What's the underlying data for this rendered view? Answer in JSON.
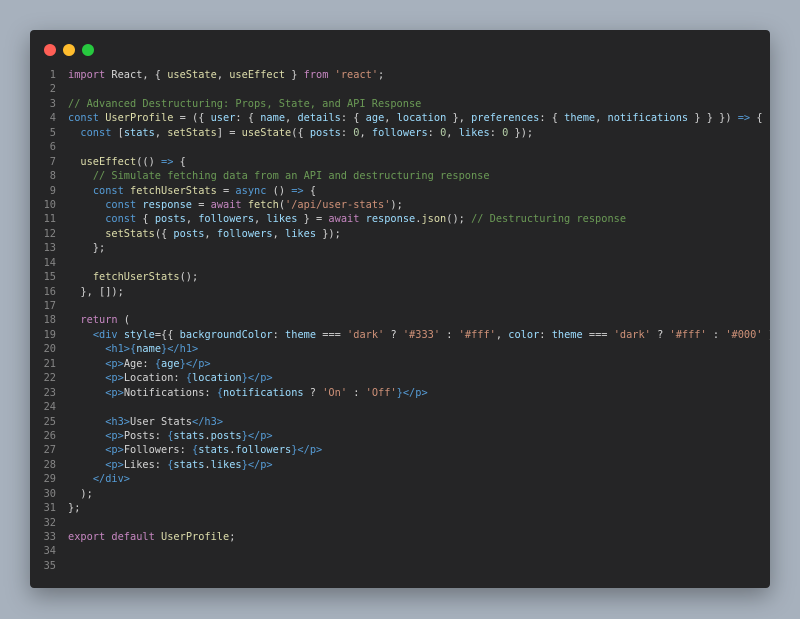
{
  "window": {
    "traffic_lights": [
      {
        "name": "close",
        "color": "#ff5f56"
      },
      {
        "name": "minimize",
        "color": "#ffbd2e"
      },
      {
        "name": "maximize",
        "color": "#27c93f"
      }
    ]
  },
  "colors": {
    "background": "#a7b1bd",
    "editor": "#252526",
    "keyword": "#c586c0",
    "storage": "#569cd6",
    "function": "#dcdcaa",
    "variable": "#9cdcfe",
    "string": "#ce9178",
    "number": "#b5cea8",
    "comment": "#6a9955",
    "text": "#d4d4d4",
    "line_number": "#858585"
  },
  "code": {
    "lines": [
      {
        "n": "1",
        "tokens": [
          [
            "kw",
            "import"
          ],
          [
            "txt",
            " React, { "
          ],
          [
            "fn",
            "useState"
          ],
          [
            "txt",
            ", "
          ],
          [
            "fn",
            "useEffect"
          ],
          [
            "txt",
            " } "
          ],
          [
            "kw",
            "from"
          ],
          [
            "txt",
            " "
          ],
          [
            "str",
            "'react'"
          ],
          [
            "txt",
            ";"
          ]
        ]
      },
      {
        "n": "2",
        "tokens": []
      },
      {
        "n": "3",
        "tokens": [
          [
            "com",
            "// Advanced Destructuring: Props, State, and API Response"
          ]
        ]
      },
      {
        "n": "4",
        "tokens": [
          [
            "kw2",
            "const"
          ],
          [
            "txt",
            " "
          ],
          [
            "fn",
            "UserProfile"
          ],
          [
            "txt",
            " = ({ "
          ],
          [
            "var",
            "user"
          ],
          [
            "txt",
            ": { "
          ],
          [
            "var",
            "name"
          ],
          [
            "txt",
            ", "
          ],
          [
            "var",
            "details"
          ],
          [
            "txt",
            ": { "
          ],
          [
            "var",
            "age"
          ],
          [
            "txt",
            ", "
          ],
          [
            "var",
            "location"
          ],
          [
            "txt",
            " }, "
          ],
          [
            "var",
            "preferences"
          ],
          [
            "txt",
            ": { "
          ],
          [
            "var",
            "theme"
          ],
          [
            "txt",
            ", "
          ],
          [
            "var",
            "notifications"
          ],
          [
            "txt",
            " } } }) "
          ],
          [
            "kw2",
            "=>"
          ],
          [
            "txt",
            " {"
          ]
        ]
      },
      {
        "n": "5",
        "tokens": [
          [
            "txt",
            "  "
          ],
          [
            "kw2",
            "const"
          ],
          [
            "txt",
            " ["
          ],
          [
            "var",
            "stats"
          ],
          [
            "txt",
            ", "
          ],
          [
            "fn",
            "setStats"
          ],
          [
            "txt",
            "] = "
          ],
          [
            "fn",
            "useState"
          ],
          [
            "txt",
            "({ "
          ],
          [
            "var",
            "posts"
          ],
          [
            "txt",
            ": "
          ],
          [
            "num",
            "0"
          ],
          [
            "txt",
            ", "
          ],
          [
            "var",
            "followers"
          ],
          [
            "txt",
            ": "
          ],
          [
            "num",
            "0"
          ],
          [
            "txt",
            ", "
          ],
          [
            "var",
            "likes"
          ],
          [
            "txt",
            ": "
          ],
          [
            "num",
            "0"
          ],
          [
            "txt",
            " });"
          ]
        ]
      },
      {
        "n": "6",
        "tokens": []
      },
      {
        "n": "7",
        "tokens": [
          [
            "txt",
            "  "
          ],
          [
            "fn",
            "useEffect"
          ],
          [
            "txt",
            "(() "
          ],
          [
            "kw2",
            "=>"
          ],
          [
            "txt",
            " {"
          ]
        ]
      },
      {
        "n": "8",
        "tokens": [
          [
            "txt",
            "    "
          ],
          [
            "com",
            "// Simulate fetching data from an API and destructuring response"
          ]
        ]
      },
      {
        "n": "9",
        "tokens": [
          [
            "txt",
            "    "
          ],
          [
            "kw2",
            "const"
          ],
          [
            "txt",
            " "
          ],
          [
            "fn",
            "fetchUserStats"
          ],
          [
            "txt",
            " = "
          ],
          [
            "kw2",
            "async"
          ],
          [
            "txt",
            " () "
          ],
          [
            "kw2",
            "=>"
          ],
          [
            "txt",
            " {"
          ]
        ]
      },
      {
        "n": "10",
        "tokens": [
          [
            "txt",
            "      "
          ],
          [
            "kw2",
            "const"
          ],
          [
            "txt",
            " "
          ],
          [
            "var",
            "response"
          ],
          [
            "txt",
            " = "
          ],
          [
            "kw",
            "await"
          ],
          [
            "txt",
            " "
          ],
          [
            "fn",
            "fetch"
          ],
          [
            "txt",
            "("
          ],
          [
            "str",
            "'/api/user-stats'"
          ],
          [
            "txt",
            ");"
          ]
        ]
      },
      {
        "n": "11",
        "tokens": [
          [
            "txt",
            "      "
          ],
          [
            "kw2",
            "const"
          ],
          [
            "txt",
            " { "
          ],
          [
            "var",
            "posts"
          ],
          [
            "txt",
            ", "
          ],
          [
            "var",
            "followers"
          ],
          [
            "txt",
            ", "
          ],
          [
            "var",
            "likes"
          ],
          [
            "txt",
            " } = "
          ],
          [
            "kw",
            "await"
          ],
          [
            "txt",
            " "
          ],
          [
            "var",
            "response"
          ],
          [
            "txt",
            "."
          ],
          [
            "fn",
            "json"
          ],
          [
            "txt",
            "(); "
          ],
          [
            "com",
            "// Destructuring response"
          ]
        ]
      },
      {
        "n": "12",
        "tokens": [
          [
            "txt",
            "      "
          ],
          [
            "fn",
            "setStats"
          ],
          [
            "txt",
            "({ "
          ],
          [
            "var",
            "posts"
          ],
          [
            "txt",
            ", "
          ],
          [
            "var",
            "followers"
          ],
          [
            "txt",
            ", "
          ],
          [
            "var",
            "likes"
          ],
          [
            "txt",
            " });"
          ]
        ]
      },
      {
        "n": "13",
        "tokens": [
          [
            "txt",
            "    };"
          ]
        ]
      },
      {
        "n": "14",
        "tokens": []
      },
      {
        "n": "15",
        "tokens": [
          [
            "txt",
            "    "
          ],
          [
            "fn",
            "fetchUserStats"
          ],
          [
            "txt",
            "();"
          ]
        ]
      },
      {
        "n": "16",
        "tokens": [
          [
            "txt",
            "  }, []);"
          ]
        ]
      },
      {
        "n": "17",
        "tokens": []
      },
      {
        "n": "18",
        "tokens": [
          [
            "txt",
            "  "
          ],
          [
            "kw",
            "return"
          ],
          [
            "txt",
            " ("
          ]
        ]
      },
      {
        "n": "19",
        "tokens": [
          [
            "txt",
            "    "
          ],
          [
            "tag",
            "<div"
          ],
          [
            "txt",
            " "
          ],
          [
            "var",
            "style"
          ],
          [
            "txt",
            "={{ "
          ],
          [
            "var",
            "backgroundColor"
          ],
          [
            "txt",
            ": "
          ],
          [
            "var",
            "theme"
          ],
          [
            "txt",
            " === "
          ],
          [
            "str",
            "'dark'"
          ],
          [
            "txt",
            " ? "
          ],
          [
            "str",
            "'#333'"
          ],
          [
            "txt",
            " : "
          ],
          [
            "str",
            "'#fff'"
          ],
          [
            "txt",
            ", "
          ],
          [
            "var",
            "color"
          ],
          [
            "txt",
            ": "
          ],
          [
            "var",
            "theme"
          ],
          [
            "txt",
            " === "
          ],
          [
            "str",
            "'dark'"
          ],
          [
            "txt",
            " ? "
          ],
          [
            "str",
            "'#fff'"
          ],
          [
            "txt",
            " : "
          ],
          [
            "str",
            "'#000'"
          ],
          [
            "txt",
            " }}"
          ],
          [
            "tag",
            ">"
          ]
        ]
      },
      {
        "n": "20",
        "tokens": [
          [
            "txt",
            "      "
          ],
          [
            "tag",
            "<h1>"
          ],
          [
            "kw2",
            "{"
          ],
          [
            "var",
            "name"
          ],
          [
            "kw2",
            "}"
          ],
          [
            "tag",
            "</h1>"
          ]
        ]
      },
      {
        "n": "21",
        "tokens": [
          [
            "txt",
            "      "
          ],
          [
            "tag",
            "<p>"
          ],
          [
            "txt",
            "Age: "
          ],
          [
            "kw2",
            "{"
          ],
          [
            "var",
            "age"
          ],
          [
            "kw2",
            "}"
          ],
          [
            "tag",
            "</p>"
          ]
        ]
      },
      {
        "n": "22",
        "tokens": [
          [
            "txt",
            "      "
          ],
          [
            "tag",
            "<p>"
          ],
          [
            "txt",
            "Location: "
          ],
          [
            "kw2",
            "{"
          ],
          [
            "var",
            "location"
          ],
          [
            "kw2",
            "}"
          ],
          [
            "tag",
            "</p>"
          ]
        ]
      },
      {
        "n": "23",
        "tokens": [
          [
            "txt",
            "      "
          ],
          [
            "tag",
            "<p>"
          ],
          [
            "txt",
            "Notifications: "
          ],
          [
            "kw2",
            "{"
          ],
          [
            "var",
            "notifications"
          ],
          [
            "txt",
            " ? "
          ],
          [
            "str",
            "'On'"
          ],
          [
            "txt",
            " : "
          ],
          [
            "str",
            "'Off'"
          ],
          [
            "kw2",
            "}"
          ],
          [
            "tag",
            "</p>"
          ]
        ]
      },
      {
        "n": "24",
        "tokens": []
      },
      {
        "n": "25",
        "tokens": [
          [
            "txt",
            "      "
          ],
          [
            "tag",
            "<h3>"
          ],
          [
            "txt",
            "User Stats"
          ],
          [
            "tag",
            "</h3>"
          ]
        ]
      },
      {
        "n": "26",
        "tokens": [
          [
            "txt",
            "      "
          ],
          [
            "tag",
            "<p>"
          ],
          [
            "txt",
            "Posts: "
          ],
          [
            "kw2",
            "{"
          ],
          [
            "var",
            "stats"
          ],
          [
            "txt",
            "."
          ],
          [
            "var",
            "posts"
          ],
          [
            "kw2",
            "}"
          ],
          [
            "tag",
            "</p>"
          ]
        ]
      },
      {
        "n": "27",
        "tokens": [
          [
            "txt",
            "      "
          ],
          [
            "tag",
            "<p>"
          ],
          [
            "txt",
            "Followers: "
          ],
          [
            "kw2",
            "{"
          ],
          [
            "var",
            "stats"
          ],
          [
            "txt",
            "."
          ],
          [
            "var",
            "followers"
          ],
          [
            "kw2",
            "}"
          ],
          [
            "tag",
            "</p>"
          ]
        ]
      },
      {
        "n": "28",
        "tokens": [
          [
            "txt",
            "      "
          ],
          [
            "tag",
            "<p>"
          ],
          [
            "txt",
            "Likes: "
          ],
          [
            "kw2",
            "{"
          ],
          [
            "var",
            "stats"
          ],
          [
            "txt",
            "."
          ],
          [
            "var",
            "likes"
          ],
          [
            "kw2",
            "}"
          ],
          [
            "tag",
            "</p>"
          ]
        ]
      },
      {
        "n": "29",
        "tokens": [
          [
            "txt",
            "    "
          ],
          [
            "tag",
            "</div>"
          ]
        ]
      },
      {
        "n": "30",
        "tokens": [
          [
            "txt",
            "  );"
          ]
        ]
      },
      {
        "n": "31",
        "tokens": [
          [
            "txt",
            "};"
          ]
        ]
      },
      {
        "n": "32",
        "tokens": []
      },
      {
        "n": "33",
        "tokens": [
          [
            "kw",
            "export"
          ],
          [
            "txt",
            " "
          ],
          [
            "kw",
            "default"
          ],
          [
            "txt",
            " "
          ],
          [
            "fn",
            "UserProfile"
          ],
          [
            "txt",
            ";"
          ]
        ]
      },
      {
        "n": "34",
        "tokens": []
      },
      {
        "n": "35",
        "tokens": []
      }
    ]
  }
}
